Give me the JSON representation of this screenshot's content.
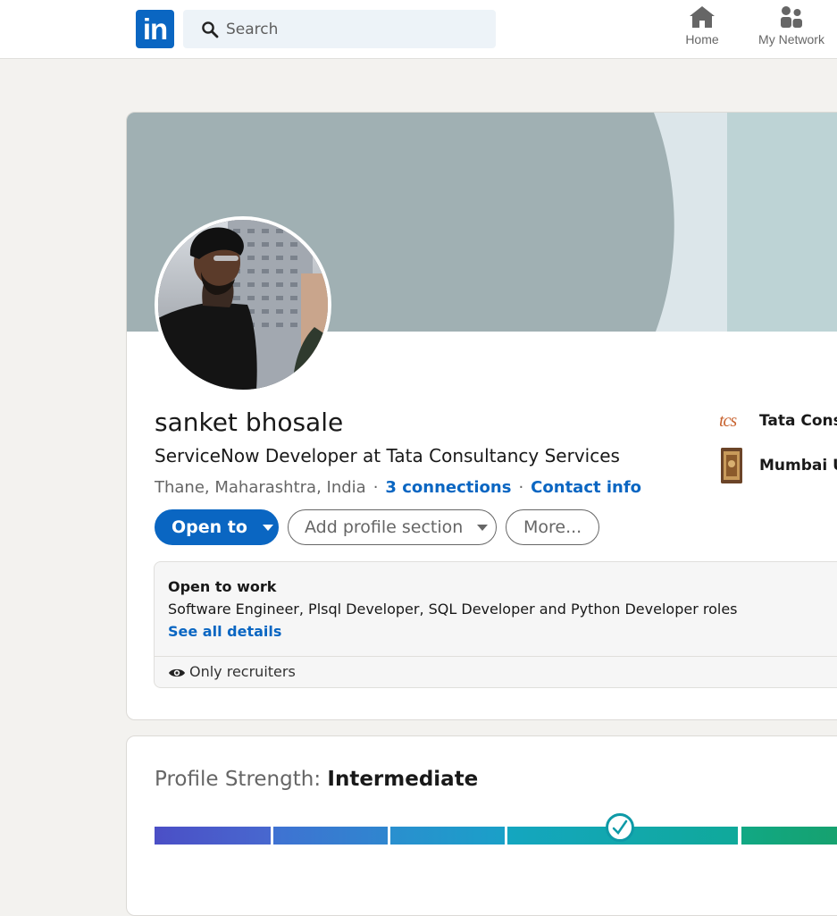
{
  "header": {
    "logo_text": "in",
    "search": {
      "placeholder": "Search",
      "value": ""
    },
    "nav": [
      {
        "label": "Home",
        "icon": "home-icon"
      },
      {
        "label": "My Network",
        "icon": "network-icon"
      }
    ]
  },
  "profile": {
    "name": "sanket bhosale",
    "headline": "ServiceNow Developer at Tata Consultancy Services",
    "location": "Thane, Maharashtra, India",
    "connections": "3 connections",
    "contact_info": "Contact info",
    "buttons": {
      "open_to": "Open to",
      "add_section": "Add profile section",
      "more": "More..."
    },
    "side": {
      "company": "Tata Consu",
      "school": "Mumbai Ur",
      "company_logo_text": "tcs"
    },
    "open_to_work": {
      "title": "Open to work",
      "roles": "Software Engineer, Plsql Developer, SQL Developer and Python Developer roles",
      "see_all": "See all details",
      "visibility": "Only recruiters"
    }
  },
  "profile_strength": {
    "label": "Profile Strength:",
    "level": "Intermediate"
  },
  "colors": {
    "brand": "#0a66c2",
    "cover_main": "#a0b0b3",
    "cover_light": "#dce6ea",
    "cover_right": "#bdd3d5",
    "background": "#f3f2ef"
  }
}
